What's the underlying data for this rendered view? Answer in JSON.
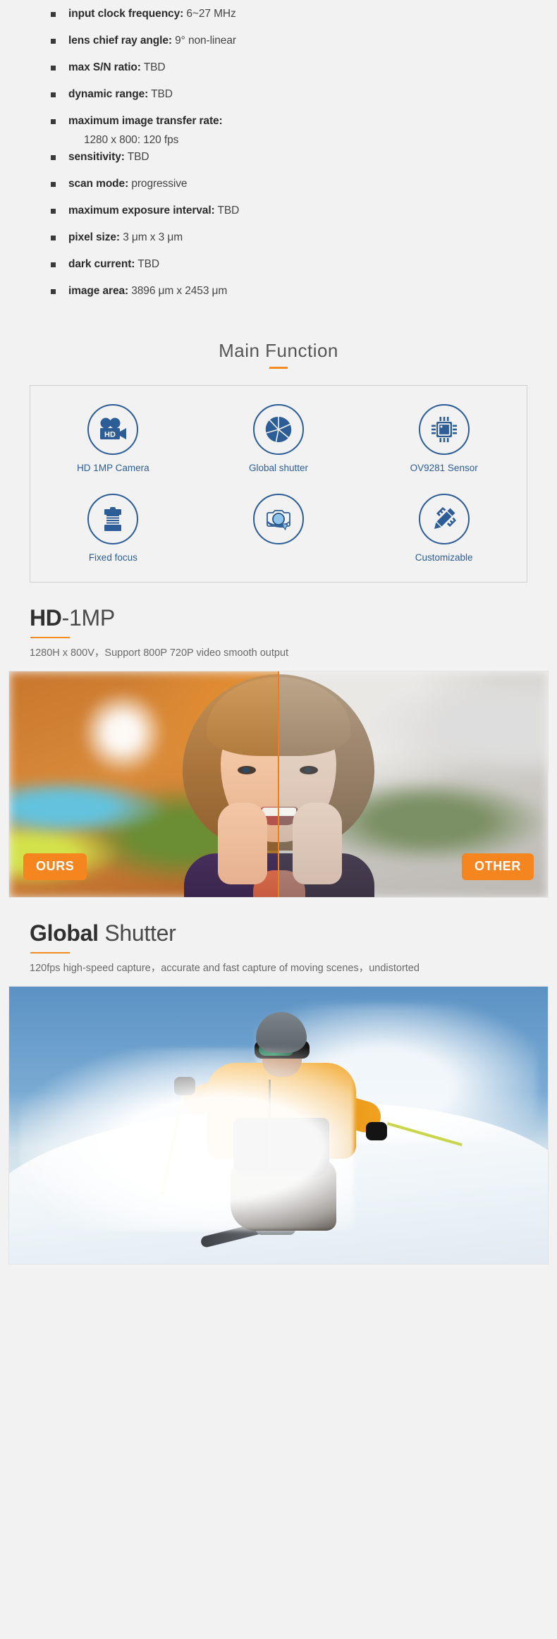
{
  "accent_orange": "#f28b20",
  "accent_blue": "#2c5d96",
  "page_bg": "#f2f2f2",
  "specs": [
    {
      "label": "input clock frequency:",
      "value": " 6~27 MHz"
    },
    {
      "label": "lens chief ray angle:",
      "value": " 9° non-linear"
    },
    {
      "label": "max S/N ratio:",
      "value": " TBD"
    },
    {
      "label": "dynamic range:",
      "value": " TBD"
    },
    {
      "label": "maximum image transfer rate:",
      "value": "",
      "sub": "1280 x 800: 120 fps"
    },
    {
      "label": "sensitivity:",
      "value": " TBD"
    },
    {
      "label": "scan mode:",
      "value": " progressive"
    },
    {
      "label": "maximum exposure interval:",
      "value": " TBD"
    },
    {
      "label": "pixel size:",
      "value": " 3 μm x 3 μm"
    },
    {
      "label": "dark current:",
      "value": " TBD"
    },
    {
      "label": "image area:",
      "value": " 3896 μm x 2453 μm"
    }
  ],
  "main_function": {
    "title": "Main Function",
    "features_row1": [
      {
        "label": "HD 1MP Camera",
        "icon": "hd-camera-icon"
      },
      {
        "label": "Global shutter",
        "icon": "aperture-shutter-icon"
      },
      {
        "label": "OV9281 Sensor",
        "icon": "cpu-chip-icon"
      }
    ],
    "features_row2": [
      {
        "label": "Fixed focus",
        "icon": "bellows-lens-icon"
      },
      {
        "label": "",
        "icon": "camera-rotate-icon"
      },
      {
        "label": "Customizable",
        "icon": "pencil-ruler-icon"
      }
    ]
  },
  "hd_block": {
    "title_strong": "HD",
    "title_light": "-1MP",
    "description": "1280H x 800V，Support 800P 720P video smooth output",
    "badge_left": "OURS",
    "badge_right": "OTHER"
  },
  "shutter_block": {
    "title_strong": "Global",
    "title_light": " Shutter",
    "description": "120fps high-speed capture，accurate and fast capture of moving scenes，undistorted"
  }
}
